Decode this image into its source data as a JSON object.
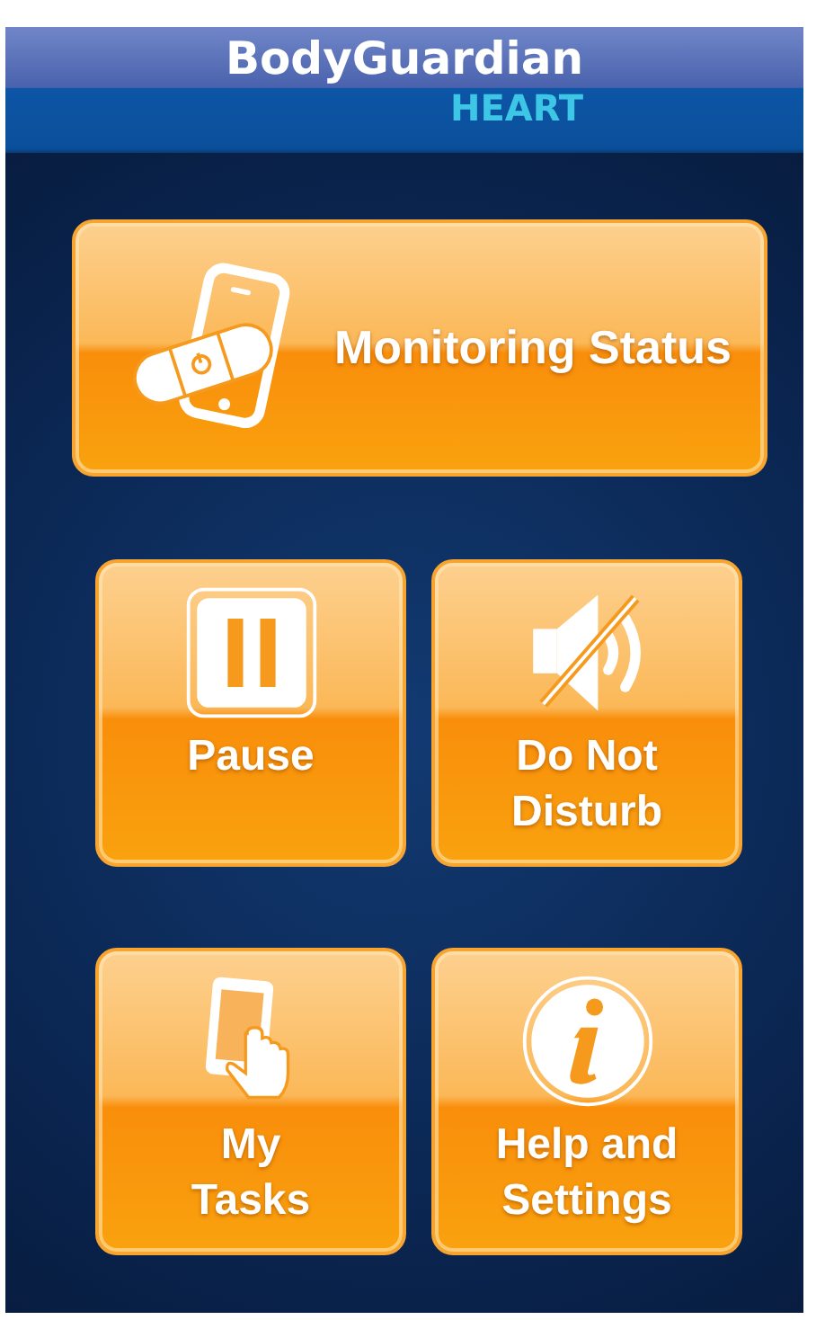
{
  "header": {
    "title": "BodyGuardian",
    "subtitle": "HEART"
  },
  "main_button": {
    "kind": "monitor",
    "lines": [
      "Monitoring Status"
    ]
  },
  "tiles": [
    {
      "kind": "pause",
      "lines": [
        "Pause"
      ]
    },
    {
      "kind": "mute",
      "lines": [
        "Do Not",
        "Disturb"
      ]
    },
    {
      "kind": "tasks",
      "lines": [
        "My",
        "Tasks"
      ]
    },
    {
      "kind": "info",
      "lines": [
        "Help and",
        "Settings"
      ]
    }
  ]
}
